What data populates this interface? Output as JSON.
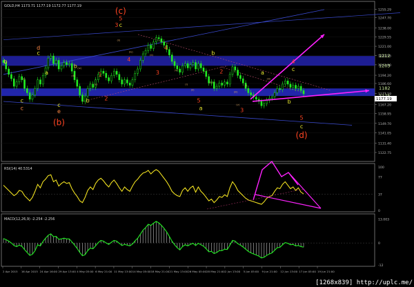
{
  "chart_data": [
    {
      "type": "candlestick",
      "title": "GOLD,H4 1173.71 1177.19 1172.77 1177.19",
      "ylim": [
        1117,
        1260
      ],
      "y_ticks": [
        1255.29,
        1247.7,
        1238.0,
        1229.55,
        1221.0,
        1212.55,
        1203.9,
        1194.2,
        1186.6,
        1177.19,
        1167.2,
        1158.95,
        1149.7,
        1141.05,
        1131.4,
        1122.75
      ],
      "current_price_label": "1177.19",
      "x_time_labels": [
        "2 Apr 2015",
        "16 Apr 2015",
        "24 Apr 16:00",
        "29 Apr 13:00",
        "4 May 05:00",
        "6 May 21:00",
        "11 May 13:00",
        "14 May 05:00",
        "18 May 21:00",
        "21 May 13:00",
        "26 May 05:00",
        "28 May 21:00",
        "2 Jun 13:00",
        "5 Jun 05:00",
        "9 Jun 21:00",
        "12 Jun 13:00",
        "17 Jun 05:00",
        "19 Jun 21:00"
      ],
      "closes": [
        1206,
        1200,
        1195,
        1191,
        1184,
        1188,
        1193,
        1190,
        1182,
        1178,
        1172,
        1176,
        1182,
        1190,
        1186,
        1194,
        1201,
        1210,
        1212,
        1205,
        1208,
        1200,
        1203,
        1206,
        1204,
        1205,
        1198,
        1190,
        1184,
        1176,
        1170,
        1175,
        1182,
        1186,
        1183,
        1190,
        1195,
        1198,
        1196,
        1192,
        1189,
        1194,
        1198,
        1195,
        1190,
        1186,
        1190,
        1187,
        1185,
        1190,
        1196,
        1200,
        1208,
        1214,
        1217,
        1222,
        1219,
        1225,
        1229,
        1228,
        1225,
        1222,
        1218,
        1213,
        1207,
        1203,
        1200,
        1197,
        1203,
        1205,
        1201,
        1204,
        1206,
        1200,
        1205,
        1201,
        1198,
        1193,
        1187,
        1188,
        1182,
        1184,
        1187,
        1185,
        1188,
        1186,
        1195,
        1202,
        1199,
        1194,
        1191,
        1187,
        1182,
        1178,
        1176,
        1174,
        1172,
        1170,
        1166,
        1168,
        1171,
        1173,
        1174,
        1178,
        1182,
        1181,
        1186,
        1189,
        1186,
        1183,
        1185,
        1182,
        1184,
        1180,
        1177
      ],
      "zones": [
        {
          "label": "1212",
          "from": 1203,
          "to": 1212
        },
        {
          "label": "1182",
          "from": 1175,
          "to": 1182
        }
      ],
      "side_labels": [
        "1212",
        "1203",
        "1182",
        "1175"
      ],
      "wave_labels": [
        {
          "text": "(c)",
          "i": 57,
          "price": 1251,
          "color": "#ff4422"
        },
        {
          "text": "5",
          "i": 57,
          "price": 1245,
          "color": "#ff4422"
        },
        {
          "text": "c",
          "i": 57,
          "price": 1239,
          "color": "#e8e830"
        },
        {
          "text": "d",
          "i": 17,
          "price": 1218,
          "color": "#ff8844"
        },
        {
          "text": "c",
          "i": 17,
          "price": 1213,
          "color": "#e8e830"
        },
        {
          "text": "(b)",
          "i": 27,
          "price": 1148,
          "color": "#ff4422"
        },
        {
          "text": "e",
          "i": 27,
          "price": 1159,
          "color": "#ff8844"
        },
        {
          "text": "c",
          "i": 27,
          "price": 1165,
          "color": "#e8e830"
        },
        {
          "text": "c",
          "i": 9,
          "price": 1162,
          "color": "#ff8844"
        },
        {
          "text": "c",
          "i": 9,
          "price": 1169,
          "color": "#e8e830"
        },
        {
          "text": "b",
          "i": 1,
          "price": 1205,
          "color": "#e8e830"
        },
        {
          "text": "a",
          "i": 21,
          "price": 1195,
          "color": "#e8e830"
        },
        {
          "text": "b",
          "i": 35,
          "price": 1201,
          "color": "#e8e830"
        },
        {
          "text": "1",
          "i": 47,
          "price": 1193,
          "color": "#ff4422"
        },
        {
          "text": "2",
          "i": 50,
          "price": 1171,
          "color": "#ff4422"
        },
        {
          "text": "3",
          "i": 55,
          "price": 1239,
          "color": "#ff4422"
        },
        {
          "text": "4",
          "i": 61,
          "price": 1207,
          "color": "#ff4422"
        },
        {
          "text": "b",
          "i": 41,
          "price": 1169,
          "color": "#e8e830"
        },
        {
          "text": "3",
          "i": 75,
          "price": 1195,
          "color": "#ff4422"
        },
        {
          "text": "4",
          "i": 79,
          "price": 1218,
          "color": "#ff4422"
        },
        {
          "text": "5",
          "i": 95,
          "price": 1169,
          "color": "#ff4422"
        },
        {
          "text": "a",
          "i": 96,
          "price": 1162,
          "color": "#e8e830"
        },
        {
          "text": "b",
          "i": 102,
          "price": 1213,
          "color": "#e8e830"
        },
        {
          "text": "2",
          "i": 106,
          "price": 1196,
          "color": "#ff4422"
        },
        {
          "text": "3",
          "i": 116,
          "price": 1160,
          "color": "#ff4422"
        },
        {
          "text": "a",
          "i": 126,
          "price": 1195,
          "color": "#e8e830"
        },
        {
          "text": "4",
          "i": 141,
          "price": 1205,
          "color": "#ff4422"
        },
        {
          "text": "c",
          "i": 141,
          "price": 1198,
          "color": "#e8e830"
        },
        {
          "text": "b",
          "i": 139,
          "price": 1168,
          "color": "#e8e830"
        },
        {
          "text": "5",
          "i": 145,
          "price": 1153,
          "color": "#ff4422"
        },
        {
          "text": "c",
          "i": 145,
          "price": 1145,
          "color": "#e8e830"
        },
        {
          "text": "(d)",
          "i": 145,
          "price": 1136,
          "color": "#ff4422"
        }
      ],
      "small_labels": [
        {
          "text": "(i)",
          "i": 10,
          "price": 1190
        },
        {
          "text": "(iii)",
          "i": 34,
          "price": 1193
        },
        {
          "text": "(iv)",
          "i": 37,
          "price": 1200
        },
        {
          "text": "(v)",
          "i": 45,
          "price": 1185
        },
        {
          "text": "(ii)",
          "i": 56,
          "price": 1226
        },
        {
          "text": "(iv)",
          "i": 62,
          "price": 1215
        },
        {
          "text": "(ii)",
          "i": 72,
          "price": 1212
        },
        {
          "text": "(v)",
          "i": 84,
          "price": 1198
        },
        {
          "text": "(i)",
          "i": 89,
          "price": 1185
        },
        {
          "text": "(ii)",
          "i": 92,
          "price": 1180
        },
        {
          "text": "(iv)",
          "i": 101,
          "price": 1187
        },
        {
          "text": "(iii)",
          "i": 113,
          "price": 1178
        },
        {
          "text": "(v)",
          "i": 114,
          "price": 1166
        },
        {
          "text": "(i)",
          "i": 118,
          "price": 1184
        },
        {
          "text": "(iii)",
          "i": 129,
          "price": 1190
        }
      ],
      "xlabel": "",
      "ylabel": ""
    },
    {
      "type": "line",
      "title": "RSI(14) 40.5314",
      "ylim": [
        0,
        100
      ],
      "y_ticks": [
        100,
        77,
        37,
        0
      ],
      "values": [
        58,
        52,
        46,
        40,
        34,
        38,
        46,
        44,
        34,
        28,
        22,
        30,
        44,
        60,
        52,
        66,
        72,
        80,
        82,
        66,
        70,
        56,
        62,
        66,
        62,
        64,
        50,
        40,
        32,
        22,
        18,
        30,
        46,
        54,
        48,
        62,
        70,
        74,
        68,
        60,
        54,
        64,
        70,
        62,
        52,
        44,
        54,
        48,
        44,
        56,
        66,
        72,
        80,
        86,
        88,
        92,
        84,
        90,
        94,
        90,
        82,
        74,
        66,
        56,
        44,
        38,
        34,
        32,
        46,
        52,
        44,
        52,
        56,
        42,
        54,
        44,
        38,
        30,
        22,
        26,
        18,
        24,
        32,
        30,
        36,
        32,
        52,
        66,
        58,
        46,
        40,
        34,
        28,
        24,
        22,
        20,
        18,
        16,
        14,
        20,
        28,
        32,
        34,
        44,
        52,
        50,
        60,
        66,
        58,
        50,
        54,
        46,
        52,
        42,
        38
      ],
      "xlabel": "",
      "ylabel": ""
    },
    {
      "type": "bar",
      "title": "MACD(12,26,9) -2.254 -2.256",
      "ylim": [
        -12,
        14
      ],
      "y_ticks": [
        13.003,
        0,
        -12
      ],
      "values": [
        2.4,
        1.8,
        1.0,
        0.0,
        -1.4,
        -2.0,
        -1.2,
        -1.8,
        -3.6,
        -5.2,
        -6.8,
        -6.2,
        -4.2,
        -1.0,
        -1.6,
        0.8,
        2.6,
        4.2,
        5.0,
        3.4,
        3.6,
        2.0,
        2.2,
        2.6,
        2.2,
        2.2,
        0.6,
        -1.2,
        -3.0,
        -5.2,
        -7.0,
        -6.4,
        -4.2,
        -2.8,
        -3.2,
        -1.6,
        0.2,
        1.4,
        1.0,
        0.0,
        -0.8,
        0.4,
        1.4,
        1.0,
        -0.2,
        -1.4,
        -0.8,
        -1.2,
        -1.6,
        -0.6,
        1.2,
        2.6,
        4.8,
        7.0,
        8.4,
        10.2,
        9.6,
        10.8,
        11.8,
        11.0,
        9.6,
        8.0,
        6.0,
        3.6,
        1.0,
        -1.0,
        -2.6,
        -3.8,
        -2.0,
        -1.0,
        -1.6,
        -0.8,
        -0.2,
        -1.4,
        -0.2,
        -1.0,
        -1.8,
        -3.2,
        -4.8,
        -4.6,
        -5.8,
        -5.2,
        -4.2,
        -4.2,
        -3.4,
        -3.6,
        -1.2,
        1.4,
        1.0,
        -0.4,
        -1.2,
        -2.2,
        -3.4,
        -4.6,
        -5.4,
        -6.0,
        -6.6,
        -7.2,
        -8.2,
        -7.8,
        -6.8,
        -6.0,
        -5.4,
        -4.0,
        -2.6,
        -2.4,
        -1.0,
        0.2,
        -0.2,
        -1.0,
        -0.8,
        -1.6,
        -1.4,
        -2.0,
        -2.3
      ],
      "xlabel": "",
      "ylabel": ""
    }
  ],
  "watermark": "[1268x839] http://uplc.me/"
}
